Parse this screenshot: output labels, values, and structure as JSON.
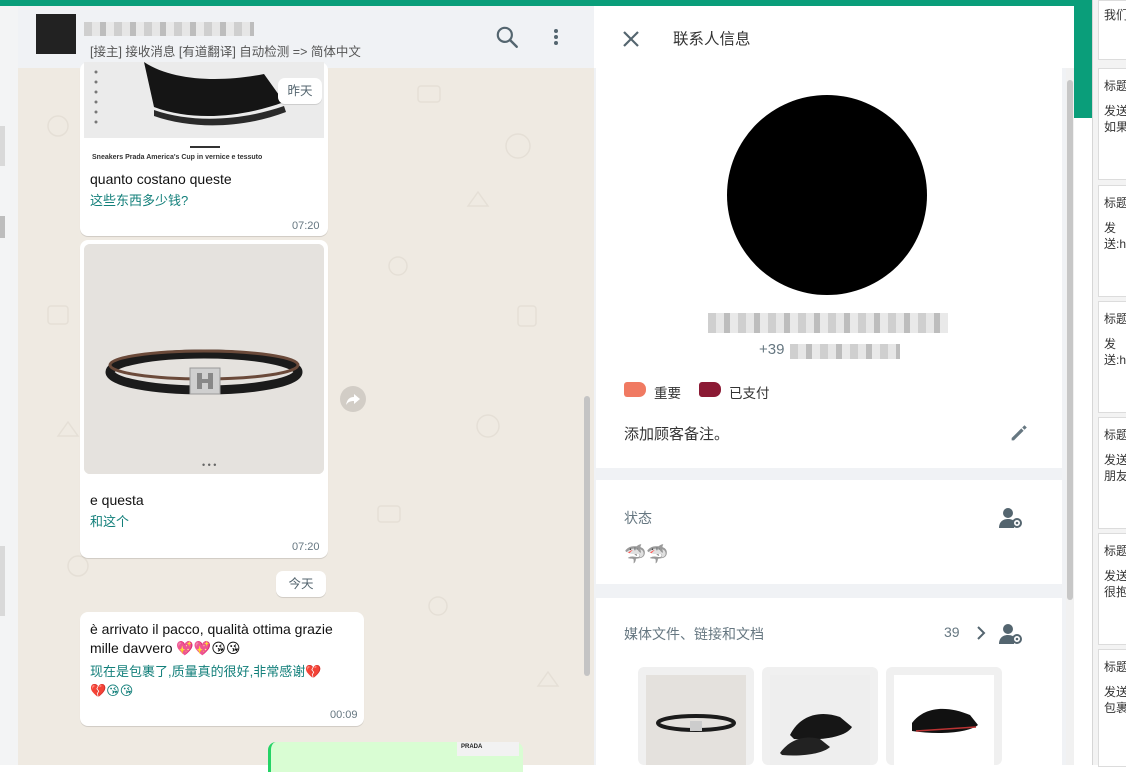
{
  "colors": {
    "accent": "#0a9e7a",
    "translation": "#127f7a",
    "tag_important": "#f07a62",
    "tag_paid": "#8b1a34"
  },
  "chat": {
    "subtitle": "[接主] 接收消息 [有道翻译] 自动检测 => 简体中文",
    "date_yesterday": "昨天",
    "date_today": "今天",
    "product_caption": "Sneakers Prada America's Cup in vernice e tessuto",
    "messages": [
      {
        "text": "quanto costano queste",
        "translation": "这些东西多少钱?",
        "time": "07:20"
      },
      {
        "text": "e questa",
        "translation": "和这个",
        "time": "07:20"
      },
      {
        "text_line1": "è arrivato il pacco, qualità ottima grazie",
        "text_line2": "mille davvero 💖💖😘😘",
        "translation_line1": "现在是包裹了,质量真的很好,非常感谢💔",
        "translation_line2": "💔😘😘",
        "time": "00:09"
      }
    ],
    "outgoing_label": "PRADA",
    "image_dots": "• • •"
  },
  "icons": {
    "search": "search-icon",
    "more": "more-vert-icon",
    "forward": "forward-icon",
    "close": "close-icon",
    "edit": "pencil-icon",
    "assign": "person-gear-icon",
    "chevron": "chevron-right-icon"
  },
  "info": {
    "title": "联系人信息",
    "phone_prefix": "+39",
    "tags": [
      {
        "label": "重要"
      },
      {
        "label": "已支付"
      }
    ],
    "note_placeholder": "添加顾客备注。",
    "status_label": "状态",
    "status_value": "🦈🦈",
    "media_label": "媒体文件、链接和文档",
    "media_count": "39"
  },
  "right_panel": {
    "top_text": "我们",
    "cards": [
      {
        "title": "标题",
        "line1": "发送",
        "line2": "如果"
      },
      {
        "title": "标题",
        "line1": "发",
        "line2": "送:h"
      },
      {
        "title": "标题",
        "line1": "发",
        "line2": "送:h"
      },
      {
        "title": "标题",
        "line1": "发送",
        "line2": "朋友"
      },
      {
        "title": "标题",
        "line1": "发送",
        "line2": "很抱"
      },
      {
        "title": "标题",
        "line1": "发送",
        "line2": "包裹"
      }
    ]
  }
}
